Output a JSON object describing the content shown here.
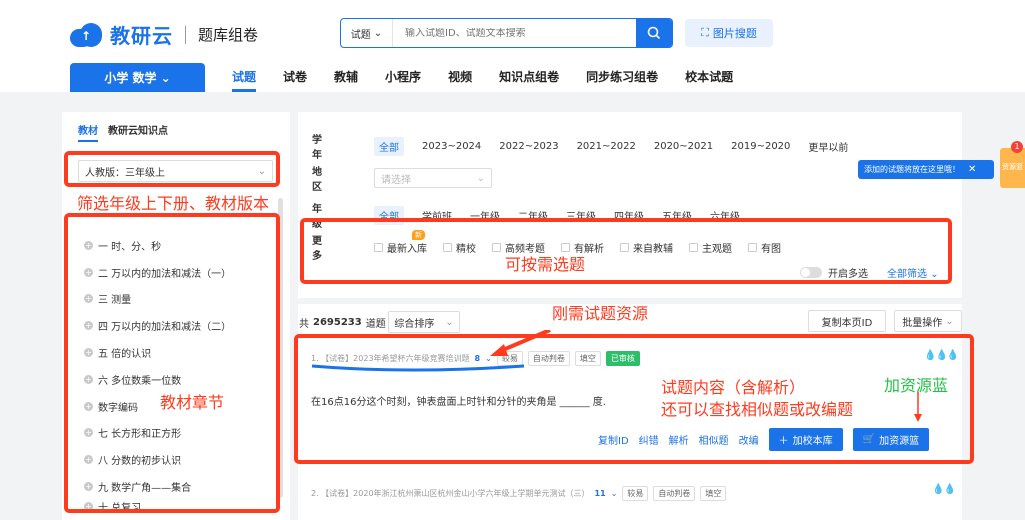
{
  "header": {
    "logo_text": "教研云",
    "logo_sub": "题库组卷",
    "search_type": "试题",
    "search_placeholder": "输入试题ID、试题文本搜索",
    "image_search": "图片搜题"
  },
  "subject": {
    "label": "小学 数学"
  },
  "nav": [
    "试题",
    "试卷",
    "教辅",
    "小程序",
    "视频",
    "知识点组卷",
    "同步练习组卷",
    "校本试题"
  ],
  "sidebar": {
    "tabs": [
      "教材",
      "教研云知识点"
    ],
    "edition": "人教版：三年级上",
    "chapters": [
      "一 时、分、秒",
      "二 万以内的加法和减法（一）",
      "三 测量",
      "四 万以内的加法和减法（二）",
      "五 倍的认识",
      "六 多位数乘一位数",
      "数字编码",
      "七 长方形和正方形",
      "八 分数的初步认识",
      "九 数学广角——集合",
      "十 总复习"
    ]
  },
  "filters": {
    "year_label": "学 年",
    "years": [
      "全部",
      "2023~2024",
      "2022~2023",
      "2021~2022",
      "2020~2021",
      "2019~2020",
      "更早以前"
    ],
    "region_label": "地 区",
    "region_placeholder": "请选择",
    "grade_label": "年 级",
    "grades": [
      "全部",
      "学前班",
      "一年级",
      "二年级",
      "三年级",
      "四年级",
      "五年级",
      "六年级"
    ],
    "more_label": "更 多",
    "more": [
      "最新入库",
      "精校",
      "高频考题",
      "有解析",
      "来自教辅",
      "主观题",
      "有图"
    ],
    "new_badge": "新",
    "multi_select": "开启多选",
    "all_filter": "全部筛选"
  },
  "tooltip": "添加的试题将放在这里哦！",
  "basket": {
    "label": "资源篮",
    "count": "1"
  },
  "list": {
    "count_prefix": "共",
    "count": "2695233",
    "count_suffix": "道题",
    "sort": "综合排序",
    "copy_page": "复制本页ID",
    "batch": "批量操作"
  },
  "questions": [
    {
      "title": "1. 【试卷】2023年希望杯六年级竞赛培训题",
      "num": "8",
      "tags": [
        "较易",
        "自动判卷",
        "填空"
      ],
      "status": "已审核",
      "text": "在16点16分这个时刻，钟表盘面上时针和分针的夹角是 ______ 度."
    },
    {
      "title": "2. 【试卷】2020年浙江杭州萧山区杭州金山小学六年级上学期单元测试（三）",
      "num": "11",
      "tags": [
        "较易",
        "自动判卷",
        "填空"
      ]
    }
  ],
  "actions": [
    "复制ID",
    "纠错",
    "解析",
    "相似题",
    "改编"
  ],
  "add_school": "加校本库",
  "add_basket": "加资源篮",
  "annotations": {
    "edition": "筛选年级上下册、教材版本",
    "filter": "可按需选题",
    "resource": "刚需试题资源",
    "chapters": "教材章节",
    "content_1": "试题内容（含解析）",
    "content_2": "还可以查找相似题或改编题",
    "basket": "加资源蓝"
  },
  "colors": {
    "accent": "#1a73e8",
    "annotation_red": "#ff3b1f",
    "annotation_green": "#22c245"
  }
}
